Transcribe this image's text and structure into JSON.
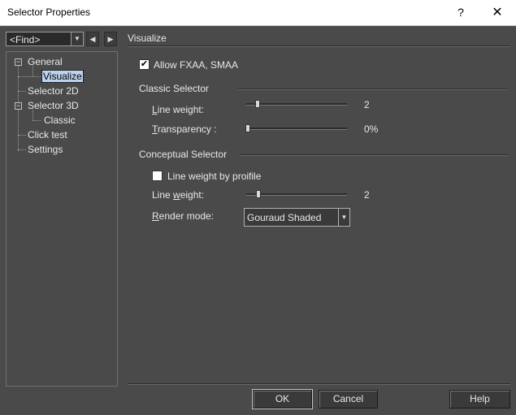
{
  "window": {
    "title": "Selector Properties",
    "help_glyph": "?",
    "close_glyph": "✕"
  },
  "find": {
    "value": "<Find>"
  },
  "tree": {
    "items": [
      {
        "label": "General",
        "expander": "−"
      },
      {
        "label": "Visualize"
      },
      {
        "label": "Selector 2D"
      },
      {
        "label": "Selector 3D",
        "expander": "−"
      },
      {
        "label": "Classic"
      },
      {
        "label": "Click test"
      },
      {
        "label": "Settings"
      }
    ],
    "selected": "Visualize"
  },
  "panel": {
    "title": "Visualize",
    "allow_fxaa": {
      "label": "Allow FXAA, SMAA",
      "checked": true
    },
    "classic": {
      "heading": "Classic Selector",
      "line_weight": {
        "label_pre": "",
        "label_u": "L",
        "label_post": "ine weight:",
        "value": "2",
        "level": 0.1
      },
      "transparency": {
        "label_pre": "",
        "label_u": "T",
        "label_post": "ransparency :",
        "value": "0%",
        "level": 0.0
      }
    },
    "conceptual": {
      "heading": "Conceptual Selector",
      "line_weight_by_profile": {
        "label": "Line weight by proifile",
        "checked": false
      },
      "line_weight": {
        "label_pre": "Line ",
        "label_u": "w",
        "label_post": "eight:",
        "value": "2",
        "level": 0.1
      },
      "render_mode": {
        "label_pre": "",
        "label_u": "R",
        "label_post": "ender mode:",
        "value": "Gouraud Shaded"
      }
    }
  },
  "buttons": {
    "ok": "OK",
    "cancel": "Cancel",
    "help": "Help"
  }
}
